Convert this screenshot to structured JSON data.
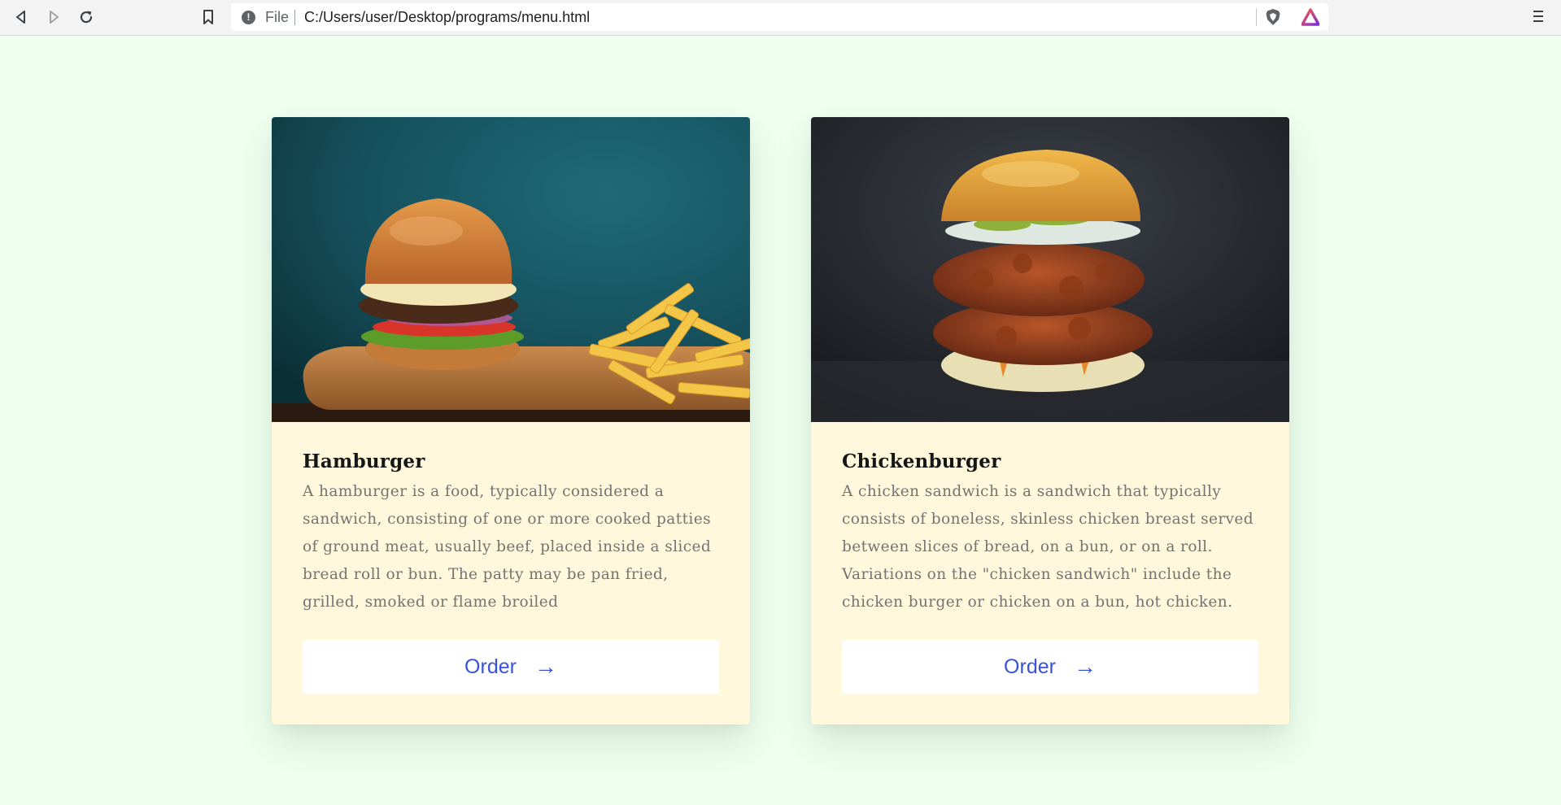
{
  "browser": {
    "scheme": "File",
    "url": "C:/Users/user/Desktop/programs/menu.html"
  },
  "icons": {
    "back": "back-arrow-icon",
    "forward": "forward-arrow-icon",
    "reload": "reload-icon",
    "bookmark": "bookmark-icon",
    "info": "info-icon",
    "brave_shield": "brave-shield-icon",
    "rewards": "brave-rewards-icon",
    "menu": "hamburger-menu-icon",
    "order_arrow": "right-arrow-icon"
  },
  "colors": {
    "page_background": "#effff0",
    "card_background": "#fff8dc",
    "button_text": "#3953d6",
    "title_text": "#161616",
    "description_text": "#737373"
  },
  "cards": [
    {
      "title": "Hamburger",
      "description": "A hamburger is a food, typically considered a sandwich, consisting of one or more cooked patties of ground meat, usually beef, placed inside a sliced bread roll or bun. The patty may be pan fried, grilled, smoked or flame broiled",
      "button_label": "Order",
      "button_arrow": "→"
    },
    {
      "title": "Chickenburger",
      "description": "A chicken sandwich is a sandwich that typically consists of boneless, skinless chicken breast served between slices of bread, on a bun, or on a roll. Variations on the \"chicken sandwich\" include the chicken burger or chicken on a bun, hot chicken.",
      "button_label": "Order",
      "button_arrow": "→"
    }
  ]
}
